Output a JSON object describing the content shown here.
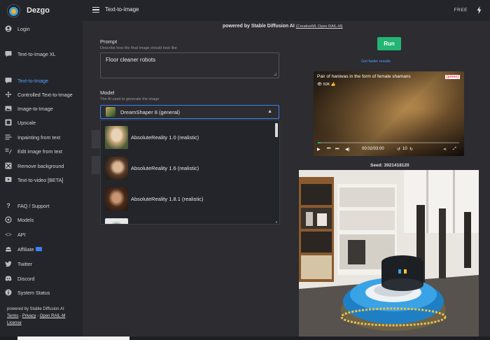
{
  "app": {
    "name": "Dezgo"
  },
  "topbar": {
    "title": "Text-to-image",
    "plan": "FREE"
  },
  "sidebar": {
    "items": [
      {
        "label": "Login",
        "icon": "user-circle-icon"
      },
      {
        "label": "Text-to-Image XL",
        "icon": "chat-icon"
      },
      {
        "label": "Text-to-Image",
        "icon": "chat-icon",
        "active": true
      },
      {
        "label": "Controlled Text-to-Image",
        "icon": "move-icon"
      },
      {
        "label": "Image-to-Image",
        "icon": "image-icon"
      },
      {
        "label": "Upscale",
        "icon": "upscale-icon"
      },
      {
        "label": "Inpainting from text",
        "icon": "inpaint-icon"
      },
      {
        "label": "Edit image from text",
        "icon": "edit-icon"
      },
      {
        "label": "Remove background",
        "icon": "remove-bg-icon"
      },
      {
        "label": "Text-to-video [BETA]",
        "icon": "video-icon"
      },
      {
        "label": "FAQ / Support",
        "icon": "question-icon"
      },
      {
        "label": "Models",
        "icon": "models-icon"
      },
      {
        "label": "API",
        "icon": "code-icon"
      },
      {
        "label": "Affiliate",
        "icon": "people-icon"
      },
      {
        "label": "Twitter",
        "icon": "twitter-icon"
      },
      {
        "label": "Discord",
        "icon": "discord-icon"
      },
      {
        "label": "System Status",
        "icon": "info-icon"
      }
    ],
    "footer": {
      "powered": "powered by Stable Diffusion AI",
      "terms": "Terms",
      "privacy": "Privacy",
      "license": "Open RAIL-M",
      "license2": "License",
      "sep": " - "
    }
  },
  "main": {
    "powered": "powered by Stable Diffusion AI",
    "license_link": "(CreativeML Open RAIL-M)",
    "prompt": {
      "label": "Prompt",
      "hint": "Describe how the final image should look like",
      "value": "Floor cleaner robots"
    },
    "model": {
      "label": "Model",
      "hint": "The AI used to generate the image",
      "selected": "DreamShaper 8 (general)",
      "options": [
        "AbsoluteReality 1.0 (realistic)",
        "AbsoluteReality 1.6 (realistic)",
        "AbsoluteReality 1.8.1 (realistic)"
      ]
    },
    "run_label": "Run",
    "faster_link": "Get faster results",
    "video": {
      "title": "Pair of haniwas in the form of female shamans",
      "brand": "[prime]",
      "views": "50K",
      "time": "00:02/03:00",
      "skip": "10",
      "progress": 0.02
    },
    "seed_text": "Seed: 3921418120"
  },
  "colors": {
    "accent": "#4fa3ff",
    "run": "#22b573",
    "bg": "#2c2c31",
    "sidebar": "#24252a"
  }
}
